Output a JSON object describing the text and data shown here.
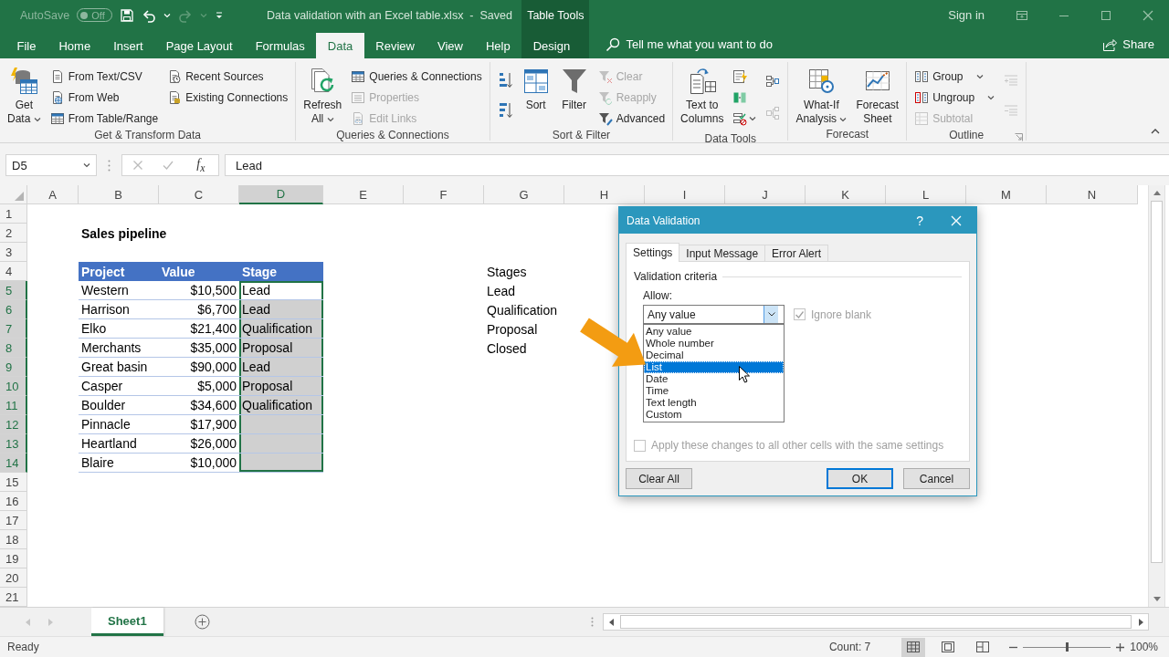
{
  "title_bar": {
    "autosave": {
      "label": "AutoSave",
      "state": "Off",
      "on": false
    },
    "document_title": "Data validation with an Excel table.xlsx  -  Saved",
    "contextual_group": "Table Tools",
    "sign_in": "Sign in"
  },
  "ribbon_tabs": [
    {
      "label": "File",
      "selected": false,
      "kind": "standard"
    },
    {
      "label": "Home",
      "selected": false,
      "kind": "standard"
    },
    {
      "label": "Insert",
      "selected": false,
      "kind": "standard"
    },
    {
      "label": "Page Layout",
      "selected": false,
      "kind": "standard"
    },
    {
      "label": "Formulas",
      "selected": false,
      "kind": "standard"
    },
    {
      "label": "Data",
      "selected": true,
      "kind": "standard"
    },
    {
      "label": "Review",
      "selected": false,
      "kind": "standard"
    },
    {
      "label": "View",
      "selected": false,
      "kind": "standard"
    },
    {
      "label": "Help",
      "selected": false,
      "kind": "standard"
    },
    {
      "label": "Design",
      "selected": false,
      "kind": "contextual"
    }
  ],
  "tell_me": {
    "placeholder": "Tell me what you want to do"
  },
  "share_button": "Share",
  "ribbon_groups": [
    {
      "title": "Get & Transform Data",
      "launcher": false,
      "columns": [
        [
          {
            "kind": "large",
            "label": "Get\nData",
            "dropdown": true,
            "disabled": false
          }
        ],
        [
          {
            "kind": "small",
            "label": "From Text/CSV",
            "dropdown": false,
            "disabled": false
          },
          {
            "kind": "small",
            "label": "From Web",
            "dropdown": false,
            "disabled": false
          },
          {
            "kind": "small",
            "label": "From Table/Range",
            "dropdown": false,
            "disabled": false
          }
        ],
        [
          {
            "kind": "small",
            "label": "Recent Sources",
            "dropdown": false,
            "disabled": false
          },
          {
            "kind": "small",
            "label": "Existing Connections",
            "dropdown": false,
            "disabled": false
          }
        ]
      ]
    },
    {
      "title": "Queries & Connections",
      "launcher": false,
      "columns": [
        [
          {
            "kind": "large",
            "label": "Refresh\nAll",
            "dropdown": true,
            "disabled": false
          }
        ],
        [
          {
            "kind": "small",
            "label": "Queries & Connections",
            "dropdown": false,
            "disabled": false
          },
          {
            "kind": "small",
            "label": "Properties",
            "dropdown": false,
            "disabled": true
          },
          {
            "kind": "small",
            "label": "Edit Links",
            "dropdown": false,
            "disabled": true
          }
        ]
      ]
    },
    {
      "title": "Sort & Filter",
      "launcher": false,
      "columns": [
        [
          {
            "kind": "icon",
            "dropdown": false,
            "disabled": false
          },
          {
            "kind": "icon",
            "dropdown": false,
            "disabled": false
          }
        ],
        [
          {
            "kind": "large",
            "label": "Sort",
            "dropdown": false,
            "disabled": false
          }
        ],
        [
          {
            "kind": "large",
            "label": "Filter",
            "dropdown": false,
            "disabled": false
          }
        ],
        [
          {
            "kind": "small",
            "label": "Clear",
            "dropdown": false,
            "disabled": true
          },
          {
            "kind": "small",
            "label": "Reapply",
            "dropdown": false,
            "disabled": true
          },
          {
            "kind": "small",
            "label": "Advanced",
            "dropdown": false,
            "disabled": false
          }
        ]
      ]
    },
    {
      "title": "Data Tools",
      "launcher": false,
      "columns": [
        [
          {
            "kind": "large",
            "label": "Text to\nColumns",
            "dropdown": false,
            "disabled": false
          }
        ],
        [
          {
            "kind": "icon",
            "dropdown": false,
            "disabled": false
          },
          {
            "kind": "icon",
            "dropdown": false,
            "disabled": false
          },
          {
            "kind": "icon",
            "dropdown": true,
            "disabled": false
          }
        ],
        [
          {
            "kind": "icon",
            "dropdown": false,
            "disabled": false
          },
          {
            "kind": "icon",
            "dropdown": false,
            "disabled": true
          }
        ]
      ]
    },
    {
      "title": "Forecast",
      "launcher": false,
      "columns": [
        [
          {
            "kind": "large",
            "label": "What-If\nAnalysis",
            "dropdown": true,
            "disabled": false
          }
        ],
        [
          {
            "kind": "large",
            "label": "Forecast\nSheet",
            "dropdown": false,
            "disabled": false
          }
        ]
      ]
    },
    {
      "title": "Outline",
      "launcher": true,
      "columns": [
        [
          {
            "kind": "small",
            "label": "Group",
            "dropdown": true,
            "disabled": false
          },
          {
            "kind": "small",
            "label": "Ungroup",
            "dropdown": true,
            "disabled": false
          },
          {
            "kind": "small",
            "label": "Subtotal",
            "dropdown": false,
            "disabled": true
          }
        ],
        [
          {
            "kind": "icon",
            "dropdown": false,
            "disabled": true
          },
          {
            "kind": "icon",
            "dropdown": false,
            "disabled": true
          }
        ]
      ]
    }
  ],
  "formula_bar": {
    "name_box": "D5",
    "function_label": "f$_{x}$",
    "value": "Lead"
  },
  "column_headers": [
    {
      "label": "A",
      "selected": false
    },
    {
      "label": "B",
      "selected": false
    },
    {
      "label": "C",
      "selected": false
    },
    {
      "label": "D",
      "selected": true
    },
    {
      "label": "E",
      "selected": false
    },
    {
      "label": "F",
      "selected": false
    },
    {
      "label": "G",
      "selected": false
    },
    {
      "label": "H",
      "selected": false
    },
    {
      "label": "I",
      "selected": false
    },
    {
      "label": "J",
      "selected": false
    },
    {
      "label": "K",
      "selected": false
    },
    {
      "label": "L",
      "selected": false
    },
    {
      "label": "M",
      "selected": false
    },
    {
      "label": "N",
      "selected": false
    }
  ],
  "row_headers": [
    {
      "label": "1",
      "selected": false
    },
    {
      "label": "2",
      "selected": false
    },
    {
      "label": "3",
      "selected": false
    },
    {
      "label": "4",
      "selected": false
    },
    {
      "label": "5",
      "selected": true
    },
    {
      "label": "6",
      "selected": true
    },
    {
      "label": "7",
      "selected": true
    },
    {
      "label": "8",
      "selected": true
    },
    {
      "label": "9",
      "selected": true
    },
    {
      "label": "10",
      "selected": true
    },
    {
      "label": "11",
      "selected": true
    },
    {
      "label": "12",
      "selected": true
    },
    {
      "label": "13",
      "selected": true
    },
    {
      "label": "14",
      "selected": true
    },
    {
      "label": "15",
      "selected": false
    },
    {
      "label": "16",
      "selected": false
    },
    {
      "label": "17",
      "selected": false
    },
    {
      "label": "18",
      "selected": false
    },
    {
      "label": "19",
      "selected": false
    },
    {
      "label": "20",
      "selected": false
    },
    {
      "label": "21",
      "selected": false
    }
  ],
  "sheet_title": "Sales pipeline",
  "table": {
    "columns": [
      "Project",
      "Value",
      "Stage"
    ],
    "rows": [
      {
        "project": "Western",
        "value": "$10,500",
        "stage": "Lead",
        "selected": true,
        "active": true
      },
      {
        "project": "Harrison",
        "value": "$6,700",
        "stage": "Lead",
        "selected": true,
        "active": false
      },
      {
        "project": "Elko",
        "value": "$21,400",
        "stage": "Qualification",
        "selected": true,
        "active": false
      },
      {
        "project": "Merchants",
        "value": "$35,000",
        "stage": "Proposal",
        "selected": true,
        "active": false
      },
      {
        "project": "Great basin",
        "value": "$90,000",
        "stage": "Lead",
        "selected": true,
        "active": false
      },
      {
        "project": "Casper",
        "value": "$5,000",
        "stage": "Proposal",
        "selected": true,
        "active": false
      },
      {
        "project": "Boulder",
        "value": "$34,600",
        "stage": "Qualification",
        "selected": true,
        "active": false
      },
      {
        "project": "Pinnacle",
        "value": "$17,900",
        "selected": true,
        "active": false
      },
      {
        "project": "Heartland",
        "value": "$26,000",
        "selected": true,
        "active": false
      },
      {
        "project": "Blaire",
        "value": "$10,000",
        "selected": true,
        "active": false
      }
    ]
  },
  "stages_list": [
    "Stages",
    "Lead",
    "Qualification",
    "Proposal",
    "Closed"
  ],
  "sheet_tabs": [
    {
      "label": "Sheet1",
      "selected": true
    }
  ],
  "status_bar": {
    "status": "Ready",
    "count": "Count: 7",
    "views": [
      {
        "kind": "normal",
        "selected": true
      },
      {
        "kind": "page_layout",
        "selected": false
      },
      {
        "kind": "page_break",
        "selected": false
      }
    ],
    "zoom": {
      "level": 0.5,
      "reading": "100%"
    }
  },
  "dialog": {
    "title": "Data Validation",
    "help": "?",
    "tabs": [
      {
        "label": "Settings",
        "selected": true
      },
      {
        "label": "Input Message",
        "selected": false
      },
      {
        "label": "Error Alert",
        "selected": false
      }
    ],
    "section": "Validation criteria",
    "allow_label": "Allow:",
    "allow_value": "Any value",
    "ignore_blank": {
      "label": "Ignore blank",
      "checked": true,
      "disabled": true
    },
    "options": [
      {
        "label": "Any value",
        "selected": false
      },
      {
        "label": "Whole number",
        "selected": false
      },
      {
        "label": "Decimal",
        "selected": false
      },
      {
        "label": "List",
        "selected": true
      },
      {
        "label": "Date",
        "selected": false
      },
      {
        "label": "Time",
        "selected": false
      },
      {
        "label": "Text length",
        "selected": false
      },
      {
        "label": "Custom",
        "selected": false
      }
    ],
    "apply_all": {
      "label": "Apply these changes to all other cells with the same settings",
      "checked": false,
      "disabled": true
    },
    "buttons": [
      {
        "label": "Clear All",
        "kind": "normal"
      },
      {
        "label": "OK",
        "kind": "default"
      },
      {
        "label": "Cancel",
        "kind": "normal"
      }
    ]
  }
}
